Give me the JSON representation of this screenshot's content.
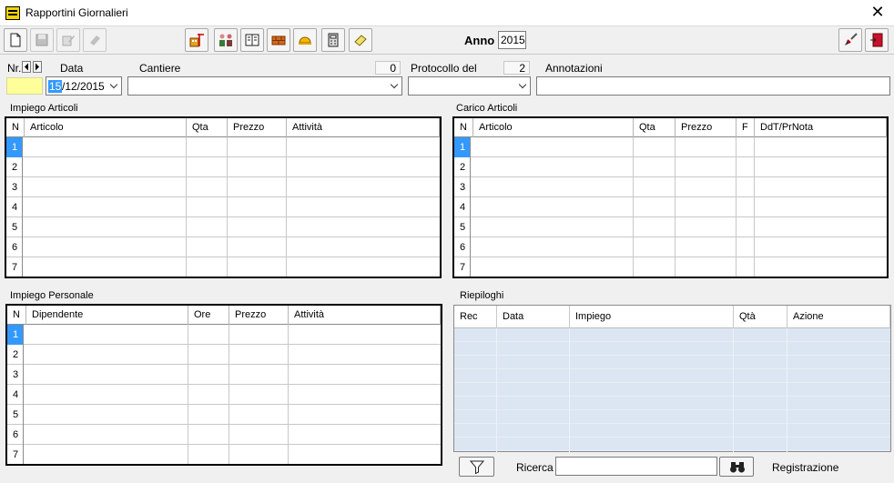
{
  "window": {
    "title": "Rapportini Giornalieri"
  },
  "toolbar": {
    "buttons": [
      {
        "name": "new-icon",
        "enabled": true
      },
      {
        "name": "save-icon",
        "enabled": false
      },
      {
        "name": "edit-icon",
        "enabled": false
      },
      {
        "name": "delete-icon",
        "enabled": false
      },
      {
        "name": "construction-site-icon",
        "enabled": true
      },
      {
        "name": "workers-icon",
        "enabled": true
      },
      {
        "name": "book-icon",
        "enabled": true
      },
      {
        "name": "bricks-icon",
        "enabled": true
      },
      {
        "name": "helmet-icon",
        "enabled": true
      },
      {
        "name": "calculator-icon",
        "enabled": true
      },
      {
        "name": "eraser-icon",
        "enabled": true
      },
      {
        "name": "brush-icon",
        "enabled": true
      },
      {
        "name": "exit-door-icon",
        "enabled": true
      }
    ],
    "anno_label": "Anno",
    "anno_value": "2015"
  },
  "header": {
    "nr_label": "Nr.",
    "data_label": "Data",
    "data_value_day": "15",
    "data_value_rest": "/12/2015",
    "cantiere_label": "Cantiere",
    "cantiere_count": "0",
    "protocollo_label": "Protocollo del",
    "protocollo_count": "2",
    "annotazioni_label": "Annotazioni"
  },
  "impiego_articoli": {
    "title": "Impiego Articoli",
    "columns": [
      "N",
      "Articolo",
      "Qta",
      "Prezzo",
      "Attività"
    ],
    "rows": [
      "1",
      "2",
      "3",
      "4",
      "5",
      "6",
      "7"
    ]
  },
  "carico_articoli": {
    "title": "Carico Articoli",
    "columns": [
      "N",
      "Articolo",
      "Qta",
      "Prezzo",
      "F",
      "DdT/PrNota"
    ],
    "rows": [
      "1",
      "2",
      "3",
      "4",
      "5",
      "6",
      "7"
    ]
  },
  "impiego_personale": {
    "title": "Impiego Personale",
    "columns": [
      "N",
      "Dipendente",
      "Ore",
      "Prezzo",
      "Attività"
    ],
    "rows": [
      "1",
      "2",
      "3",
      "4",
      "5",
      "6",
      "7"
    ]
  },
  "riepiloghi": {
    "title": "Riepiloghi",
    "columns": [
      "Rec",
      "Data",
      "Impiego",
      "Qtà",
      "Azione"
    ],
    "ricerca_label": "Ricerca",
    "registrazione_label": "Registrazione"
  },
  "colors": {
    "selection": "#3399ff",
    "nr_field": "#ffff99",
    "summary_bg": "#dbe6f2"
  }
}
